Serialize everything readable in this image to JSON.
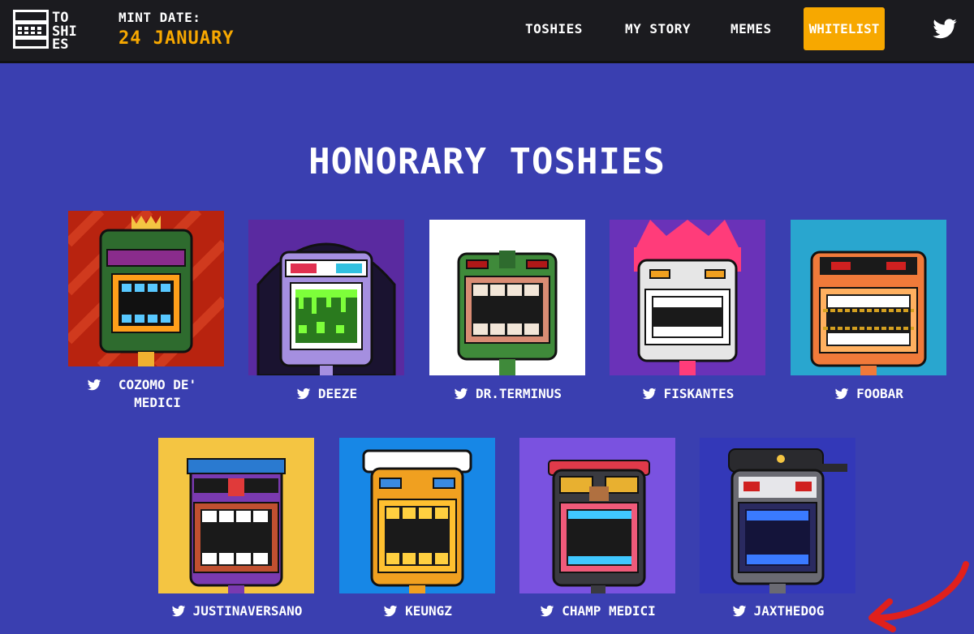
{
  "header": {
    "logo_rows": [
      "TO",
      "SHI",
      "ES"
    ],
    "mint_label": "MINT DATE:",
    "mint_date": "24 JANUARY",
    "nav": [
      {
        "label": "TOSHIES"
      },
      {
        "label": "MY STORY"
      },
      {
        "label": "MEMES"
      }
    ],
    "whitelist_label": "WHITELIST",
    "twitter_icon": "twitter-icon"
  },
  "main": {
    "title": "HONORARY TOSHIES",
    "row1": [
      {
        "name": "COZOMO DE' MEDICI",
        "bg": "#b8230f"
      },
      {
        "name": "DEEZE",
        "bg": "#5a2aa0"
      },
      {
        "name": "DR.TERMINUS",
        "bg": "#ffffff"
      },
      {
        "name": "FISKANTES",
        "bg": "#6a32b8"
      },
      {
        "name": "FOOBAR",
        "bg": "#29a6cf"
      }
    ],
    "row2": [
      {
        "name": "JUSTINAVERSANO",
        "bg": "#f4c542"
      },
      {
        "name": "KEUNGZ",
        "bg": "#1787e6"
      },
      {
        "name": "CHAMP MEDICI",
        "bg": "#7a52e0"
      },
      {
        "name": "JAXTHEDOG",
        "bg": "#3338b8"
      }
    ]
  },
  "colors": {
    "background": "#3a3fb0",
    "header": "#1b1b1f",
    "accent": "#f7a800",
    "arrow": "#e0201c"
  }
}
